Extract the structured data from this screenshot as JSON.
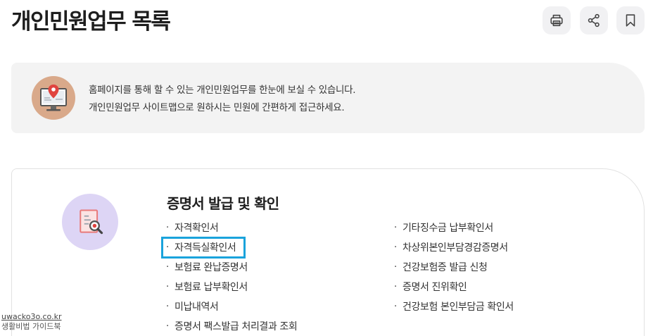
{
  "header": {
    "title": "개인민원업무 목록"
  },
  "toolbar": {
    "print_icon": "printer-icon",
    "share_icon": "share-icon",
    "bookmark_icon": "bookmark-icon"
  },
  "info": {
    "icon": "monitor-map-pin-icon",
    "line1": "홈페이지를 통해 할 수 있는 개인민원업무를 한눈에 보실 수 있습니다.",
    "line2": "개인민원업무 사이트맵으로 원하시는 민원에 간편하게 접근하세요."
  },
  "section": {
    "icon": "document-search-icon",
    "title": "증명서 발급 및 확인",
    "bullet": "·",
    "col1": [
      "자격확인서",
      "자격득실확인서",
      "보험료 완납증명서",
      "보험료 납부확인서",
      "미납내역서",
      "증명서 팩스발급 처리결과 조회"
    ],
    "col2": [
      "기타징수금 납부확인서",
      "차상위본인부담경감증명서",
      "건강보험증 발급 신청",
      "증명서 진위확인",
      "건강보험 본인부담금 확인서"
    ],
    "highlighted_item": "자격득실확인서"
  },
  "watermark": {
    "url": "uwacko3o.co.kr",
    "caption": "생활비법 가이드북"
  },
  "colors": {
    "highlight_border": "#1aa3dc",
    "cert_icon_bg": "#ddd5f5",
    "info_icon_bg": "#d9a98a",
    "box_bg": "#f3f3f3"
  }
}
